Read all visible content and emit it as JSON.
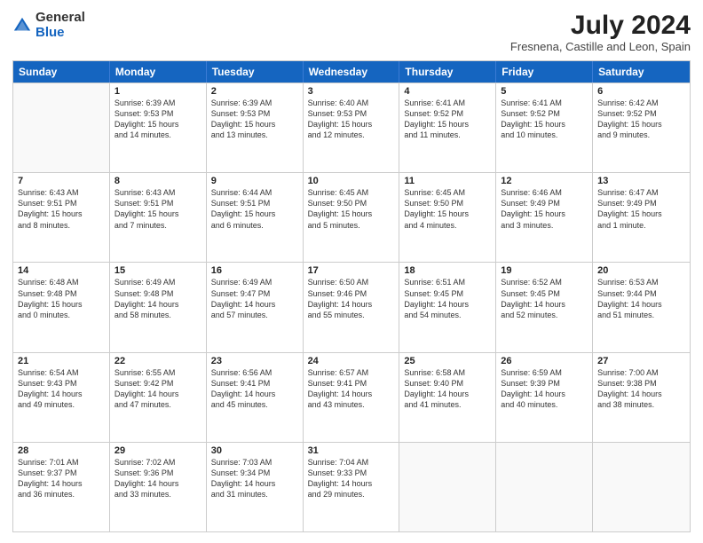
{
  "logo": {
    "general": "General",
    "blue": "Blue"
  },
  "header": {
    "month_year": "July 2024",
    "location": "Fresnena, Castille and Leon, Spain"
  },
  "weekdays": [
    "Sunday",
    "Monday",
    "Tuesday",
    "Wednesday",
    "Thursday",
    "Friday",
    "Saturday"
  ],
  "rows": [
    [
      {
        "day": "",
        "lines": []
      },
      {
        "day": "1",
        "lines": [
          "Sunrise: 6:39 AM",
          "Sunset: 9:53 PM",
          "Daylight: 15 hours",
          "and 14 minutes."
        ]
      },
      {
        "day": "2",
        "lines": [
          "Sunrise: 6:39 AM",
          "Sunset: 9:53 PM",
          "Daylight: 15 hours",
          "and 13 minutes."
        ]
      },
      {
        "day": "3",
        "lines": [
          "Sunrise: 6:40 AM",
          "Sunset: 9:53 PM",
          "Daylight: 15 hours",
          "and 12 minutes."
        ]
      },
      {
        "day": "4",
        "lines": [
          "Sunrise: 6:41 AM",
          "Sunset: 9:52 PM",
          "Daylight: 15 hours",
          "and 11 minutes."
        ]
      },
      {
        "day": "5",
        "lines": [
          "Sunrise: 6:41 AM",
          "Sunset: 9:52 PM",
          "Daylight: 15 hours",
          "and 10 minutes."
        ]
      },
      {
        "day": "6",
        "lines": [
          "Sunrise: 6:42 AM",
          "Sunset: 9:52 PM",
          "Daylight: 15 hours",
          "and 9 minutes."
        ]
      }
    ],
    [
      {
        "day": "7",
        "lines": [
          "Sunrise: 6:43 AM",
          "Sunset: 9:51 PM",
          "Daylight: 15 hours",
          "and 8 minutes."
        ]
      },
      {
        "day": "8",
        "lines": [
          "Sunrise: 6:43 AM",
          "Sunset: 9:51 PM",
          "Daylight: 15 hours",
          "and 7 minutes."
        ]
      },
      {
        "day": "9",
        "lines": [
          "Sunrise: 6:44 AM",
          "Sunset: 9:51 PM",
          "Daylight: 15 hours",
          "and 6 minutes."
        ]
      },
      {
        "day": "10",
        "lines": [
          "Sunrise: 6:45 AM",
          "Sunset: 9:50 PM",
          "Daylight: 15 hours",
          "and 5 minutes."
        ]
      },
      {
        "day": "11",
        "lines": [
          "Sunrise: 6:45 AM",
          "Sunset: 9:50 PM",
          "Daylight: 15 hours",
          "and 4 minutes."
        ]
      },
      {
        "day": "12",
        "lines": [
          "Sunrise: 6:46 AM",
          "Sunset: 9:49 PM",
          "Daylight: 15 hours",
          "and 3 minutes."
        ]
      },
      {
        "day": "13",
        "lines": [
          "Sunrise: 6:47 AM",
          "Sunset: 9:49 PM",
          "Daylight: 15 hours",
          "and 1 minute."
        ]
      }
    ],
    [
      {
        "day": "14",
        "lines": [
          "Sunrise: 6:48 AM",
          "Sunset: 9:48 PM",
          "Daylight: 15 hours",
          "and 0 minutes."
        ]
      },
      {
        "day": "15",
        "lines": [
          "Sunrise: 6:49 AM",
          "Sunset: 9:48 PM",
          "Daylight: 14 hours",
          "and 58 minutes."
        ]
      },
      {
        "day": "16",
        "lines": [
          "Sunrise: 6:49 AM",
          "Sunset: 9:47 PM",
          "Daylight: 14 hours",
          "and 57 minutes."
        ]
      },
      {
        "day": "17",
        "lines": [
          "Sunrise: 6:50 AM",
          "Sunset: 9:46 PM",
          "Daylight: 14 hours",
          "and 55 minutes."
        ]
      },
      {
        "day": "18",
        "lines": [
          "Sunrise: 6:51 AM",
          "Sunset: 9:45 PM",
          "Daylight: 14 hours",
          "and 54 minutes."
        ]
      },
      {
        "day": "19",
        "lines": [
          "Sunrise: 6:52 AM",
          "Sunset: 9:45 PM",
          "Daylight: 14 hours",
          "and 52 minutes."
        ]
      },
      {
        "day": "20",
        "lines": [
          "Sunrise: 6:53 AM",
          "Sunset: 9:44 PM",
          "Daylight: 14 hours",
          "and 51 minutes."
        ]
      }
    ],
    [
      {
        "day": "21",
        "lines": [
          "Sunrise: 6:54 AM",
          "Sunset: 9:43 PM",
          "Daylight: 14 hours",
          "and 49 minutes."
        ]
      },
      {
        "day": "22",
        "lines": [
          "Sunrise: 6:55 AM",
          "Sunset: 9:42 PM",
          "Daylight: 14 hours",
          "and 47 minutes."
        ]
      },
      {
        "day": "23",
        "lines": [
          "Sunrise: 6:56 AM",
          "Sunset: 9:41 PM",
          "Daylight: 14 hours",
          "and 45 minutes."
        ]
      },
      {
        "day": "24",
        "lines": [
          "Sunrise: 6:57 AM",
          "Sunset: 9:41 PM",
          "Daylight: 14 hours",
          "and 43 minutes."
        ]
      },
      {
        "day": "25",
        "lines": [
          "Sunrise: 6:58 AM",
          "Sunset: 9:40 PM",
          "Daylight: 14 hours",
          "and 41 minutes."
        ]
      },
      {
        "day": "26",
        "lines": [
          "Sunrise: 6:59 AM",
          "Sunset: 9:39 PM",
          "Daylight: 14 hours",
          "and 40 minutes."
        ]
      },
      {
        "day": "27",
        "lines": [
          "Sunrise: 7:00 AM",
          "Sunset: 9:38 PM",
          "Daylight: 14 hours",
          "and 38 minutes."
        ]
      }
    ],
    [
      {
        "day": "28",
        "lines": [
          "Sunrise: 7:01 AM",
          "Sunset: 9:37 PM",
          "Daylight: 14 hours",
          "and 36 minutes."
        ]
      },
      {
        "day": "29",
        "lines": [
          "Sunrise: 7:02 AM",
          "Sunset: 9:36 PM",
          "Daylight: 14 hours",
          "and 33 minutes."
        ]
      },
      {
        "day": "30",
        "lines": [
          "Sunrise: 7:03 AM",
          "Sunset: 9:34 PM",
          "Daylight: 14 hours",
          "and 31 minutes."
        ]
      },
      {
        "day": "31",
        "lines": [
          "Sunrise: 7:04 AM",
          "Sunset: 9:33 PM",
          "Daylight: 14 hours",
          "and 29 minutes."
        ]
      },
      {
        "day": "",
        "lines": []
      },
      {
        "day": "",
        "lines": []
      },
      {
        "day": "",
        "lines": []
      }
    ]
  ]
}
